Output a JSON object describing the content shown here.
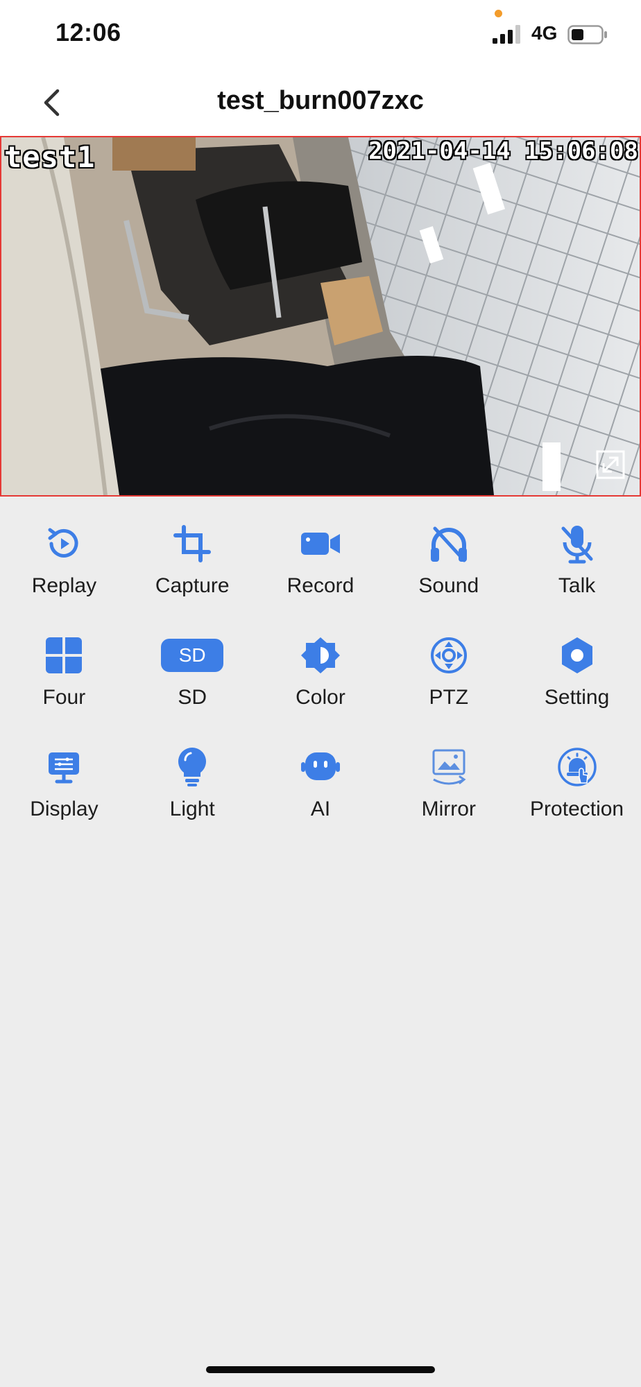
{
  "status_bar": {
    "time": "12:06",
    "network": "4G"
  },
  "header": {
    "title": "test_burn007zxc"
  },
  "video": {
    "osd_label": "test1",
    "osd_timestamp": "2021-04-14 15:06:08"
  },
  "controls": [
    {
      "label": "Replay",
      "icon": "replay-icon"
    },
    {
      "label": "Capture",
      "icon": "crop-icon"
    },
    {
      "label": "Record",
      "icon": "video-camera-icon"
    },
    {
      "label": "Sound",
      "icon": "headphones-muted-icon"
    },
    {
      "label": "Talk",
      "icon": "microphone-muted-icon"
    },
    {
      "label": "Four",
      "icon": "grid-four-icon"
    },
    {
      "label": "SD",
      "icon": "sd-badge-icon",
      "badge": "SD"
    },
    {
      "label": "Color",
      "icon": "brightness-icon"
    },
    {
      "label": "PTZ",
      "icon": "ptz-joystick-icon"
    },
    {
      "label": "Setting",
      "icon": "gear-icon"
    },
    {
      "label": "Display",
      "icon": "display-settings-icon"
    },
    {
      "label": "Light",
      "icon": "lightbulb-icon"
    },
    {
      "label": "AI",
      "icon": "robot-face-icon"
    },
    {
      "label": "Mirror",
      "icon": "mirror-image-icon"
    },
    {
      "label": "Protection",
      "icon": "alarm-protection-icon"
    }
  ],
  "colors": {
    "accent": "#3d7ee6",
    "video_border": "#e53935",
    "background": "#ededed"
  }
}
